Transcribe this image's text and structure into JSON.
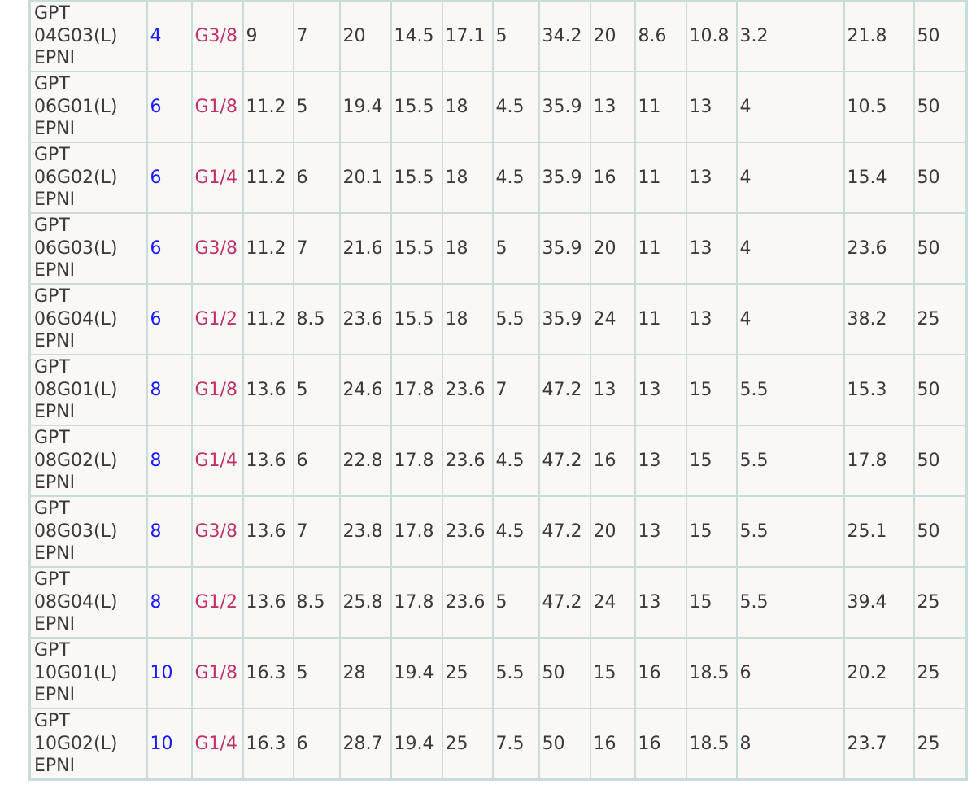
{
  "colors": {
    "size_text": "#1a1aff",
    "thread_text": "#c0306a",
    "body_text": "#3a3a3a",
    "grid": "#c9dcdc",
    "cell_bg": "#faf8f5"
  },
  "rows": [
    {
      "model": [
        "GPT",
        "04G03(L)",
        "EPNI"
      ],
      "size": "4",
      "thread": "G3/8",
      "v": [
        "9",
        "7",
        "20",
        "14.5",
        "17.1",
        "5",
        "34.2",
        "20",
        "8.6",
        "10.8",
        "3.2",
        "21.8",
        "50"
      ]
    },
    {
      "model": [
        "GPT",
        "06G01(L)",
        "EPNI"
      ],
      "size": "6",
      "thread": "G1/8",
      "v": [
        "11.2",
        "5",
        "19.4",
        "15.5",
        "18",
        "4.5",
        "35.9",
        "13",
        "11",
        "13",
        "4",
        "10.5",
        "50"
      ]
    },
    {
      "model": [
        "GPT",
        "06G02(L)",
        "EPNI"
      ],
      "size": "6",
      "thread": "G1/4",
      "v": [
        "11.2",
        "6",
        "20.1",
        "15.5",
        "18",
        "4.5",
        "35.9",
        "16",
        "11",
        "13",
        "4",
        "15.4",
        "50"
      ]
    },
    {
      "model": [
        "GPT",
        "06G03(L)",
        "EPNI"
      ],
      "size": "6",
      "thread": "G3/8",
      "v": [
        "11.2",
        "7",
        "21.6",
        "15.5",
        "18",
        "5",
        "35.9",
        "20",
        "11",
        "13",
        "4",
        "23.6",
        "50"
      ]
    },
    {
      "model": [
        "GPT",
        "06G04(L)",
        "EPNI"
      ],
      "size": "6",
      "thread": "G1/2",
      "v": [
        "11.2",
        "8.5",
        "23.6",
        "15.5",
        "18",
        "5.5",
        "35.9",
        "24",
        "11",
        "13",
        "4",
        "38.2",
        "25"
      ]
    },
    {
      "model": [
        "GPT",
        "08G01(L)",
        "EPNI"
      ],
      "size": "8",
      "thread": "G1/8",
      "v": [
        "13.6",
        "5",
        "24.6",
        "17.8",
        "23.6",
        "7",
        "47.2",
        "13",
        "13",
        "15",
        "5.5",
        "15.3",
        "50"
      ]
    },
    {
      "model": [
        "GPT",
        "08G02(L)",
        "EPNI"
      ],
      "size": "8",
      "thread": "G1/4",
      "v": [
        "13.6",
        "6",
        "22.8",
        "17.8",
        "23.6",
        "4.5",
        "47.2",
        "16",
        "13",
        "15",
        "5.5",
        "17.8",
        "50"
      ]
    },
    {
      "model": [
        "GPT",
        "08G03(L)",
        "EPNI"
      ],
      "size": "8",
      "thread": "G3/8",
      "v": [
        "13.6",
        "7",
        "23.8",
        "17.8",
        "23.6",
        "4.5",
        "47.2",
        "20",
        "13",
        "15",
        "5.5",
        "25.1",
        "50"
      ]
    },
    {
      "model": [
        "GPT",
        "08G04(L)",
        "EPNI"
      ],
      "size": "8",
      "thread": "G1/2",
      "v": [
        "13.6",
        "8.5",
        "25.8",
        "17.8",
        "23.6",
        "5",
        "47.2",
        "24",
        "13",
        "15",
        "5.5",
        "39.4",
        "25"
      ]
    },
    {
      "model": [
        "GPT",
        "10G01(L)",
        "EPNI"
      ],
      "size": "10",
      "thread": "G1/8",
      "v": [
        "16.3",
        "5",
        "28",
        "19.4",
        "25",
        "5.5",
        "50",
        "15",
        "16",
        "18.5",
        "6",
        "20.2",
        "25"
      ]
    },
    {
      "model": [
        "GPT",
        "10G02(L)",
        "EPNI"
      ],
      "size": "10",
      "thread": "G1/4",
      "v": [
        "16.3",
        "6",
        "28.7",
        "19.4",
        "25",
        "7.5",
        "50",
        "16",
        "16",
        "18.5",
        "8",
        "23.7",
        "25"
      ]
    }
  ]
}
